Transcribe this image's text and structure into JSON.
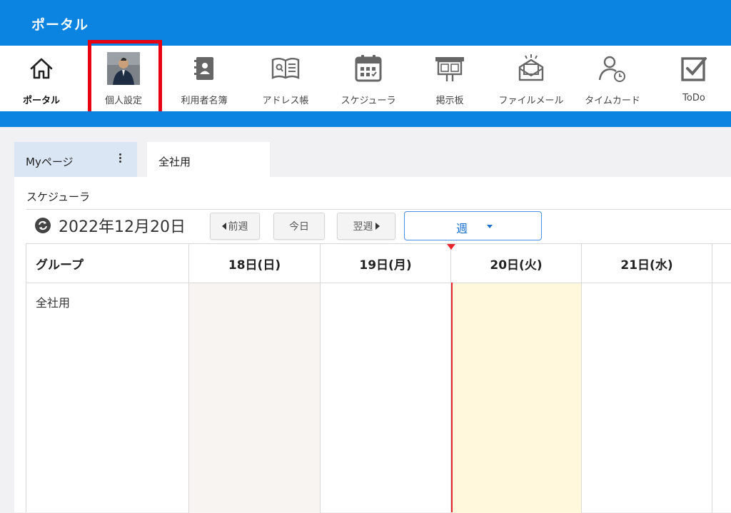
{
  "app": {
    "title": "ポータル"
  },
  "nav": {
    "items": [
      {
        "label": "ポータル",
        "icon": "home-icon"
      },
      {
        "label": "個人設定",
        "icon": "user-photo-avatar"
      },
      {
        "label": "利用者名簿",
        "icon": "contact-book-icon"
      },
      {
        "label": "アドレス帳",
        "icon": "address-book-icon"
      },
      {
        "label": "スケジューラ",
        "icon": "calendar-icon"
      },
      {
        "label": "掲示板",
        "icon": "bulletin-board-icon"
      },
      {
        "label": "ファイルメール",
        "icon": "file-mail-icon"
      },
      {
        "label": "タイムカード",
        "icon": "timecard-icon"
      },
      {
        "label": "ToDo",
        "icon": "todo-check-icon"
      }
    ],
    "active_index": 0,
    "highlighted_index": 1
  },
  "tabs": [
    {
      "label": "Myページ"
    },
    {
      "label": "全社用"
    }
  ],
  "panel": {
    "title": "スケジューラ",
    "date": "2022年12月20日",
    "prev_label": "前週",
    "today_label": "今日",
    "next_label": "翌週",
    "view_select": "週"
  },
  "grid": {
    "group_header": "グループ",
    "group_name": "全社用",
    "days": [
      "18日(日)",
      "19日(月)",
      "20日(火)",
      "21日(水)"
    ]
  },
  "colors": {
    "brand_blue": "#0a84e0",
    "highlight_red": "#e60012",
    "today_bg": "#fff8dc",
    "sunday_bg": "#f8f4f2",
    "now_line": "#e8262d"
  }
}
